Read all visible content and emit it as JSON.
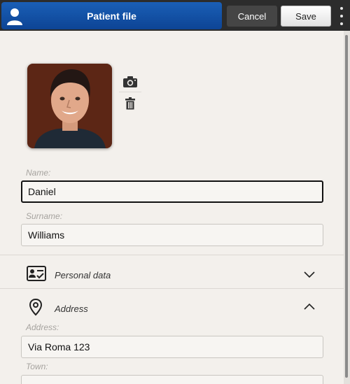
{
  "header": {
    "title": "Patient file",
    "cancel_label": "Cancel",
    "save_label": "Save",
    "title_bg": "#0d4495",
    "icons": {
      "user": "user-icon",
      "menu": "kebab-menu-icon"
    }
  },
  "photo": {
    "alt": "Patient photo",
    "actions": [
      "camera-icon",
      "trash-icon"
    ]
  },
  "form": {
    "name": {
      "label": "Name:",
      "value": "Daniel"
    },
    "surname": {
      "label": "Surname:",
      "value": "Williams"
    }
  },
  "sections": {
    "personal": {
      "title": "Personal data",
      "icon": "id-card-icon",
      "state": "collapsed"
    },
    "address": {
      "title": "Address",
      "icon": "map-pin-icon",
      "state": "expanded"
    }
  },
  "address_form": {
    "address": {
      "label": "Address:",
      "value": "Via Roma 123"
    },
    "town": {
      "label": "Town:",
      "value": ""
    }
  }
}
